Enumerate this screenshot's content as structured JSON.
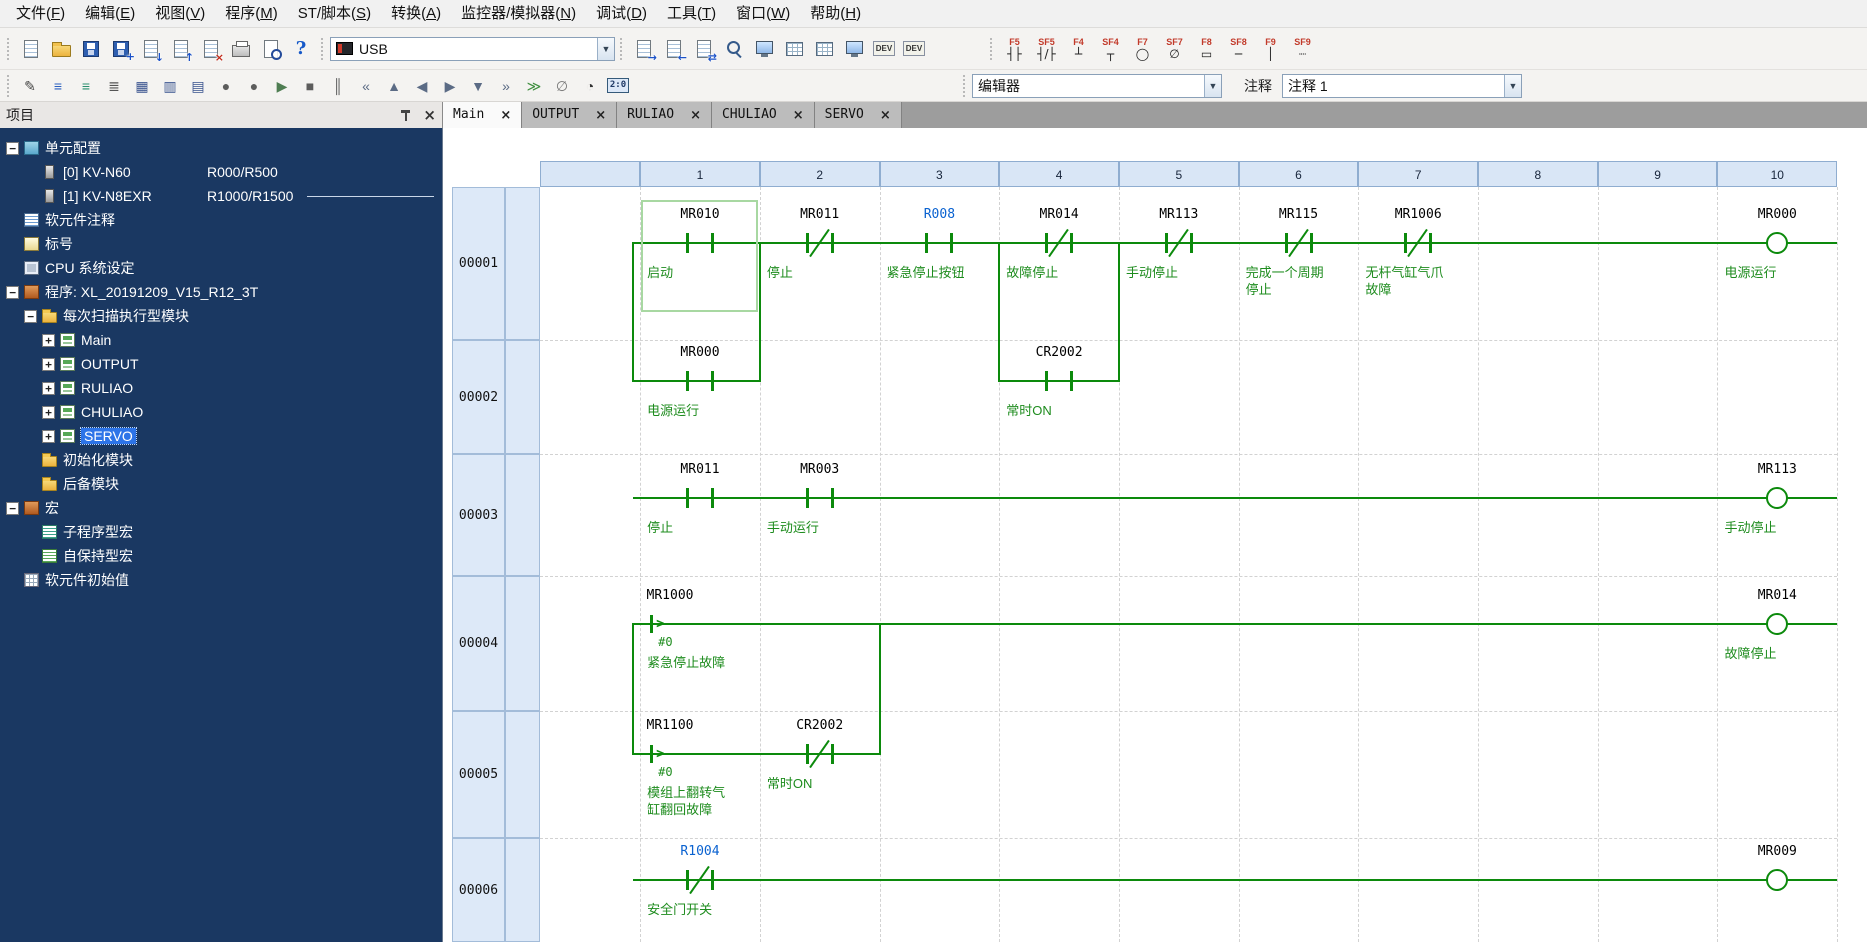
{
  "colors": {
    "wire_green": "#0c8a0c",
    "label_green": "#1e8c1e",
    "device_blue": "#0a62d0",
    "selection_green": "#a8d8a2",
    "sidebar_bg": "#1a3862",
    "tree_selected_bg": "#2d74e8"
  },
  "menu": {
    "items": [
      "文件(F)",
      "编辑(E)",
      "视图(V)",
      "程序(M)",
      "ST/脚本(S)",
      "转换(A)",
      "监控器/模拟器(N)",
      "调试(D)",
      "工具(T)",
      "窗口(W)",
      "帮助(H)"
    ]
  },
  "toolbar1": {
    "usb_value": "USB",
    "icons": [
      {
        "name": "new-file-icon",
        "type": "page"
      },
      {
        "name": "open-project-icon",
        "type": "folder"
      },
      {
        "name": "save-project-icon",
        "type": "save"
      },
      {
        "name": "save-as-icon",
        "type": "save",
        "overlay": "+"
      },
      {
        "name": "import-icon",
        "type": "page",
        "overlay": "↓"
      },
      {
        "name": "export-icon",
        "type": "page",
        "overlay": "↑"
      },
      {
        "name": "delete-icon",
        "type": "page",
        "overlay": "×",
        "overlay_color": "#c22a1a"
      },
      {
        "name": "print-icon",
        "type": "print"
      },
      {
        "name": "print-preview-icon",
        "type": "preview"
      },
      {
        "name": "help-icon",
        "type": "help",
        "text": "?"
      }
    ],
    "icons2": [
      {
        "name": "transfer-to-plc-icon",
        "type": "page",
        "overlay": "→"
      },
      {
        "name": "transfer-from-plc-icon",
        "type": "page",
        "overlay": "←"
      },
      {
        "name": "verify-icon",
        "type": "page",
        "overlay": "⇄"
      },
      {
        "name": "monitor-icon",
        "type": "magnify"
      },
      {
        "name": "simulator-icon",
        "type": "monitor"
      },
      {
        "name": "registration-monitor-icon",
        "type": "grid"
      },
      {
        "name": "batch-monitor-icon",
        "type": "grid"
      },
      {
        "name": "device-monitor-icon",
        "type": "monitor"
      },
      {
        "name": "dev-button-icon",
        "type": "dev",
        "text": "DEV"
      },
      {
        "name": "dev2-button-icon",
        "type": "dev",
        "text": "DEV"
      }
    ],
    "fkeys": [
      {
        "label": "F5",
        "glyph": "┤├"
      },
      {
        "label": "SF5",
        "glyph": "┤/├"
      },
      {
        "label": "F4",
        "glyph": "┴"
      },
      {
        "label": "SF4",
        "glyph": "┬"
      },
      {
        "label": "F7",
        "glyph": "◯"
      },
      {
        "label": "SF7",
        "glyph": "∅"
      },
      {
        "label": "F8",
        "glyph": "▭"
      },
      {
        "label": "SF8",
        "glyph": "─"
      },
      {
        "label": "F9",
        "glyph": "│"
      },
      {
        "label": "SF9",
        "glyph": "┈"
      }
    ]
  },
  "toolbar2": {
    "editor_value": "编辑器",
    "comment_label": "注释",
    "comment_value": "注释 1",
    "icons": [
      {
        "name": "edit-mode-icon",
        "glyph": "✎",
        "color": "#444444"
      },
      {
        "name": "comment-list-icon",
        "glyph": "≡",
        "color": "#2a5fc0"
      },
      {
        "name": "comment-list2-icon",
        "glyph": "≡",
        "color": "#2a8f6f"
      },
      {
        "name": "comment-edit-icon",
        "glyph": "≣",
        "color": "#555555"
      },
      {
        "name": "window-split-icon",
        "glyph": "▦",
        "color": "#39538f"
      },
      {
        "name": "window-cascade-icon",
        "glyph": "▥",
        "color": "#39538f"
      },
      {
        "name": "screen-icon",
        "glyph": "▤",
        "color": "#39538f"
      },
      {
        "name": "monitor-record-icon",
        "glyph": "●",
        "color": "#5c5c5c"
      },
      {
        "name": "monitor-record2-icon",
        "glyph": "●",
        "color": "#5c5c5c"
      },
      {
        "name": "play-icon",
        "glyph": "▶",
        "color": "#4e7d52"
      },
      {
        "name": "stop-icon",
        "glyph": "■",
        "color": "#5c5c5c"
      },
      {
        "name": "pause-icon",
        "glyph": "║",
        "color": "#5c5c5c"
      },
      {
        "name": "jump-start-icon",
        "glyph": "«",
        "color": "#5b6b85"
      },
      {
        "name": "step-up-icon",
        "glyph": "▲",
        "color": "#5b6b85"
      },
      {
        "name": "step-back-icon",
        "glyph": "◀",
        "color": "#5b6b85"
      },
      {
        "name": "step-forward-icon",
        "glyph": "▶",
        "color": "#5b6b85"
      },
      {
        "name": "step-down-icon",
        "glyph": "▼",
        "color": "#5b6b85"
      },
      {
        "name": "jump-end-icon",
        "glyph": "»",
        "color": "#5b6b85"
      },
      {
        "name": "run-to-icon",
        "glyph": "≫",
        "color": "#3f8f3f"
      },
      {
        "name": "disable-icon",
        "glyph": "∅",
        "color": "#777777"
      },
      {
        "name": "clock-icon",
        "glyph": "◔",
        "color": "#333333"
      },
      {
        "name": "time-chart-icon",
        "glyph": "2:0",
        "color": "#203a66",
        "badge": true
      }
    ]
  },
  "project": {
    "title": "项目",
    "tree": [
      {
        "id": "unit-config",
        "level": 0,
        "expander": "minus",
        "icon": "unit",
        "label": "单元配置"
      },
      {
        "id": "unit-0",
        "level": 1,
        "icon": "board",
        "label": "[0] KV-N60",
        "extra": "R000/R500"
      },
      {
        "id": "unit-1",
        "level": 1,
        "icon": "board",
        "label": "[1] KV-N8EXR",
        "extra": "R1000/R1500",
        "line_after": true
      },
      {
        "id": "device-comment",
        "level": 0,
        "icon": "doc",
        "label": "软元件注释"
      },
      {
        "id": "label",
        "level": 0,
        "icon": "tag",
        "label": "标号"
      },
      {
        "id": "cpu-settings",
        "level": 0,
        "icon": "cpu",
        "label": "CPU 系统设定"
      },
      {
        "id": "program",
        "level": 0,
        "expander": "minus",
        "icon": "prog",
        "label": "程序: XL_20191209_V15_R12_3T"
      },
      {
        "id": "scan-module",
        "level": 1,
        "expander": "minus",
        "icon": "folder",
        "label": "每次扫描执行型模块"
      },
      {
        "id": "main",
        "level": 2,
        "expander": "plus",
        "icon": "ladder",
        "label": "Main"
      },
      {
        "id": "output",
        "level": 2,
        "expander": "plus",
        "icon": "ladder",
        "label": "OUTPUT"
      },
      {
        "id": "ruliao",
        "level": 2,
        "expander": "plus",
        "icon": "ladder",
        "label": "RULIAO"
      },
      {
        "id": "chuliao",
        "level": 2,
        "expander": "plus",
        "icon": "ladder",
        "label": "CHULIAO"
      },
      {
        "id": "servo",
        "level": 2,
        "expander": "plus",
        "icon": "ladder",
        "label": "SERVO",
        "selected": true
      },
      {
        "id": "init-module",
        "level": 1,
        "icon": "folder",
        "label": "初始化模块"
      },
      {
        "id": "backup-module",
        "level": 1,
        "icon": "folder",
        "label": "后备模块"
      },
      {
        "id": "macro",
        "level": 0,
        "expander": "minus",
        "icon": "prog",
        "label": "宏"
      },
      {
        "id": "macro-sub",
        "level": 1,
        "icon": "doc2",
        "label": "子程序型宏"
      },
      {
        "id": "macro-hold",
        "level": 1,
        "icon": "doc3",
        "label": "自保持型宏"
      },
      {
        "id": "device-init",
        "level": 0,
        "icon": "grid",
        "label": "软元件初始值"
      }
    ]
  },
  "tabs": [
    {
      "label": "Main",
      "active": true
    },
    {
      "label": "OUTPUT",
      "active": false
    },
    {
      "label": "RULIAO",
      "active": false
    },
    {
      "label": "CHULIAO",
      "active": false
    },
    {
      "label": "SERVO",
      "active": false
    }
  ],
  "ladder": {
    "column_headers": [
      "1",
      "2",
      "3",
      "4",
      "5",
      "6",
      "7",
      "8",
      "9",
      "10"
    ],
    "rows": [
      {
        "num": "00001"
      },
      {
        "num": "00002"
      },
      {
        "num": "00003"
      },
      {
        "num": "00004"
      },
      {
        "num": "00005"
      },
      {
        "num": "00006"
      }
    ],
    "elements": [
      {
        "row": 0,
        "col": 1,
        "type": "no",
        "device": "MR010",
        "label": "启动",
        "selected": true
      },
      {
        "row": 0,
        "col": 2,
        "type": "nc",
        "device": "MR011",
        "label": "停止"
      },
      {
        "row": 0,
        "col": 3,
        "type": "no",
        "device": "R008",
        "device_color": "blue",
        "label": "紧急停止按钮"
      },
      {
        "row": 0,
        "col": 4,
        "type": "nc",
        "device": "MR014",
        "label": "故障停止"
      },
      {
        "row": 0,
        "col": 5,
        "type": "nc",
        "device": "MR113",
        "label": "手动停止"
      },
      {
        "row": 0,
        "col": 6,
        "type": "nc",
        "device": "MR115",
        "label": "完成一个周期|停止"
      },
      {
        "row": 0,
        "col": 7,
        "type": "nc",
        "device": "MR1006",
        "label": "无杆气缸气爪|故障"
      },
      {
        "row": 0,
        "col": 10,
        "type": "coil",
        "device": "MR000",
        "label": "电源运行"
      },
      {
        "row": 1,
        "col": 1,
        "type": "no",
        "device": "MR000",
        "label": "电源运行"
      },
      {
        "row": 1,
        "col": 4,
        "type": "no",
        "device": "CR2002",
        "label": "常时ON"
      },
      {
        "row": 2,
        "col": 1,
        "type": "no",
        "device": "MR011",
        "label": "停止"
      },
      {
        "row": 2,
        "col": 2,
        "type": "no",
        "device": "MR003",
        "label": "手动运行"
      },
      {
        "row": 2,
        "col": 10,
        "type": "coil",
        "device": "MR113",
        "label": "手动停止"
      },
      {
        "row": 3,
        "col": 1,
        "type": "cmp",
        "device": "MR1000",
        "operand": "#0",
        "label": "紧急停止故障"
      },
      {
        "row": 3,
        "col": 10,
        "type": "coil",
        "device": "MR014",
        "label": "故障停止"
      },
      {
        "row": 4,
        "col": 1,
        "type": "cmp",
        "device": "MR1100",
        "operand": "#0",
        "label": "模组上翻转气|缸翻回故障"
      },
      {
        "row": 4,
        "col": 2,
        "type": "nc",
        "device": "CR2002",
        "label": "常时ON"
      },
      {
        "row": 5,
        "col": 1,
        "type": "nc",
        "device": "R1004",
        "device_color": "blue",
        "label": "安全门开关"
      },
      {
        "row": 5,
        "col": 10,
        "type": "coil",
        "device": "MR009",
        "label": ""
      }
    ]
  }
}
